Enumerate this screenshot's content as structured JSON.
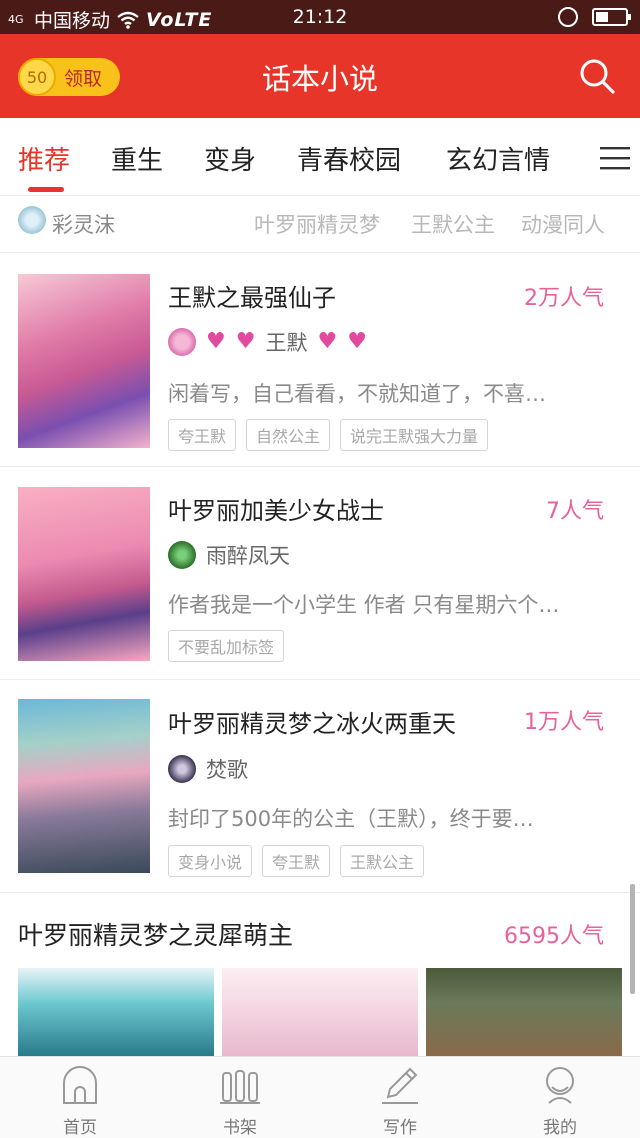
{
  "status_bar": {
    "signal_label": "4G",
    "carrier": "中国移动",
    "network": "VoLTE",
    "time": "21:12"
  },
  "header": {
    "coin_amount": "50",
    "claim_label": "领取",
    "title": "话本小说"
  },
  "tabs": [
    "推荐",
    "重生",
    "变身",
    "青春校园",
    "玄幻言情"
  ],
  "subtags": {
    "user_name": "彩灵沫",
    "tags": [
      "叶罗丽精灵梦",
      "王默公主",
      "动漫同人"
    ]
  },
  "books": [
    {
      "title": "王默之最强仙子",
      "popularity": "2万人气",
      "author": "王默",
      "description": "闲着写，自己看看，不就知道了，不喜…",
      "tags": [
        "夸王默",
        "自然公主",
        "说完王默强大力量"
      ]
    },
    {
      "title": "叶罗丽加美少女战士",
      "popularity": "7人气",
      "author": "雨醉凤天",
      "description": "作者我是一个小学生 作者 只有星期六个…",
      "tags": [
        "不要乱加标签"
      ]
    },
    {
      "title": "叶罗丽精灵梦之冰火两重天",
      "popularity": "1万人气",
      "author": "焚歌",
      "description": "封印了500年的公主（王默），终于要…",
      "tags": [
        "变身小说",
        "夸王默",
        "王默公主"
      ]
    }
  ],
  "section": {
    "title": "叶罗丽精灵梦之灵犀萌主",
    "popularity": "6595人气"
  },
  "bottom_nav": [
    "首页",
    "书架",
    "写作",
    "我的"
  ],
  "colors": {
    "brand_red": "#e8352a",
    "popularity_pink": "#e8619a",
    "coin_yellow": "#f8c21a"
  }
}
